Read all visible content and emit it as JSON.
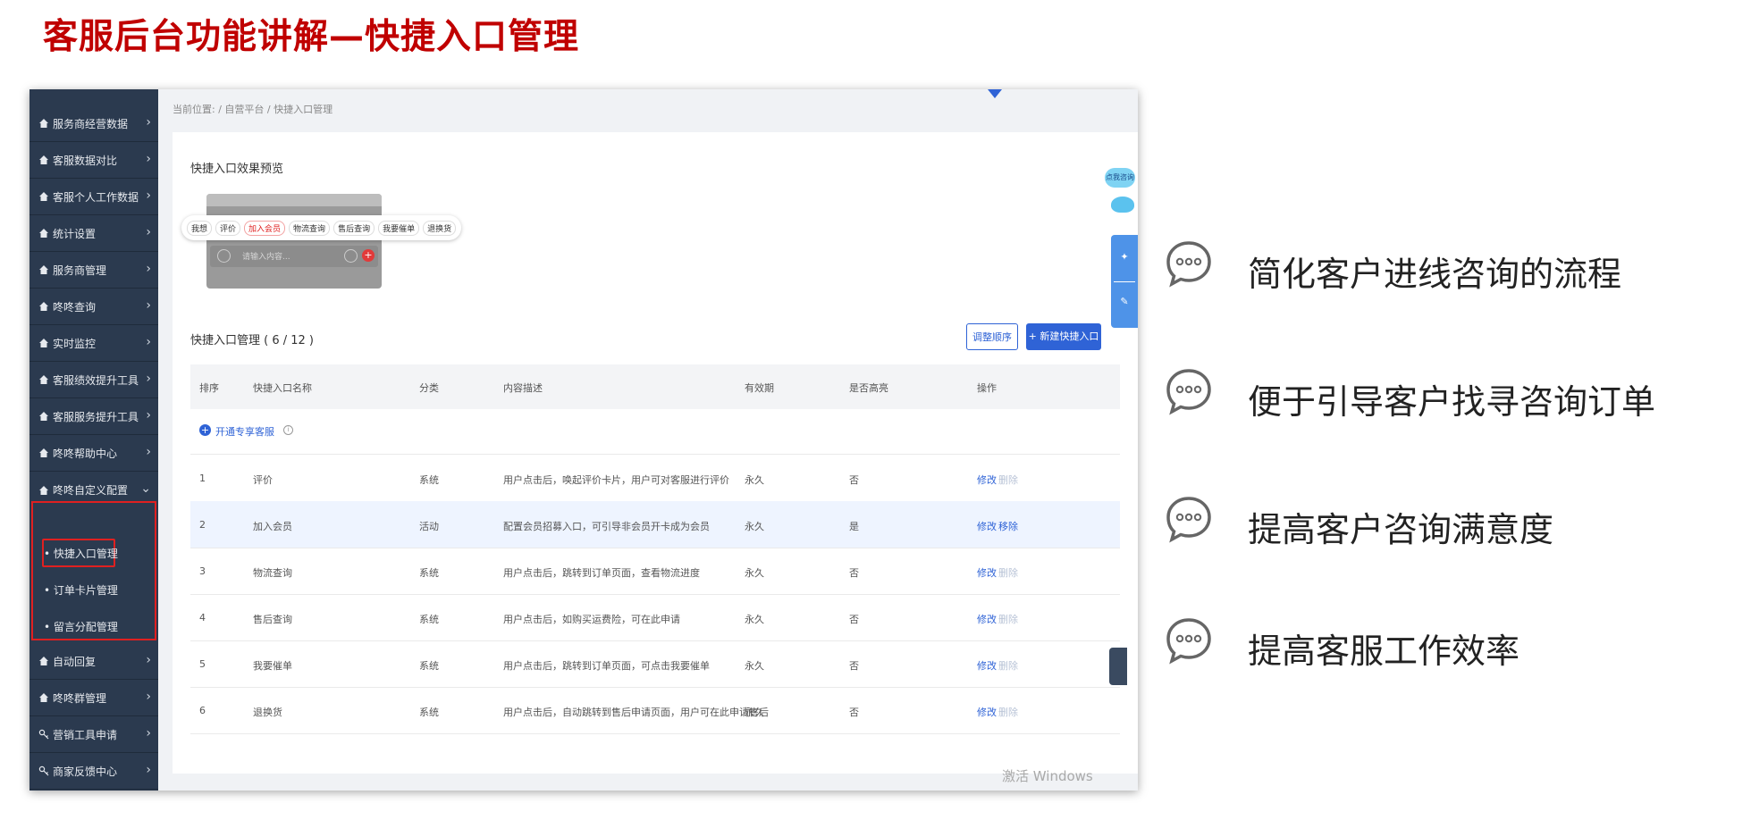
{
  "slide": {
    "title": "客服后台功能讲解—快捷入口管理"
  },
  "app": {
    "breadcrumb": "当前位置: / 自营平台 / 快捷入口管理",
    "sidebar": {
      "items": [
        {
          "label": "服务商经营数据"
        },
        {
          "label": "客服数据对比"
        },
        {
          "label": "客服个人工作数据"
        },
        {
          "label": "统计设置"
        },
        {
          "label": "服务商管理"
        },
        {
          "label": "咚咚查询"
        },
        {
          "label": "实时监控"
        },
        {
          "label": "客服绩效提升工具"
        },
        {
          "label": "客服服务提升工具"
        },
        {
          "label": "咚咚帮助中心"
        },
        {
          "label": "咚咚自定义配置"
        }
      ],
      "sub_items": [
        {
          "label": "• 快捷入口管理"
        },
        {
          "label": "• 订单卡片管理"
        },
        {
          "label": "• 留言分配管理"
        }
      ],
      "items_after": [
        {
          "label": "自动回复"
        },
        {
          "label": "咚咚群管理"
        },
        {
          "label": "营销工具申请"
        },
        {
          "label": "商家反馈中心"
        }
      ]
    },
    "preview": {
      "title": "快捷入口效果预览",
      "chips": [
        "我想",
        "评价",
        "加入会员",
        "物流查询",
        "售后查询",
        "我要催单",
        "退换货"
      ],
      "input_placeholder": "请输入内容...",
      "plus": "+"
    },
    "management": {
      "title": "快捷入口管理 ( 6 / 12 )",
      "adjust_order_label": "调整顺序",
      "new_entry_label": "+ 新建快捷入口",
      "columns": [
        "排序",
        "快捷入口名称",
        "分类",
        "内容描述",
        "有效期",
        "是否高亮",
        "操作"
      ],
      "open_exclusive_label": "开通专享客服",
      "open_plus": "+",
      "info": "i",
      "rows": [
        {
          "order": "1",
          "name": "评价",
          "category": "系统",
          "desc": "用户点击后，唤起评价卡片，用户可对客服进行评价",
          "validity": "永久",
          "highlight": "否",
          "edit": "修改",
          "remove": "删除"
        },
        {
          "order": "2",
          "name": "加入会员",
          "category": "活动",
          "desc": "配置会员招募入口，可引导非会员开卡成为会员",
          "validity": "永久",
          "highlight": "是",
          "edit": "修改",
          "remove": "移除"
        },
        {
          "order": "3",
          "name": "物流查询",
          "category": "系统",
          "desc": "用户点击后，跳转到订单页面，查看物流进度",
          "validity": "永久",
          "highlight": "否",
          "edit": "修改",
          "remove": "删除"
        },
        {
          "order": "4",
          "name": "售后查询",
          "category": "系统",
          "desc": "用户点击后，如购买运费险，可在此申请",
          "validity": "永久",
          "highlight": "否",
          "edit": "修改",
          "remove": "删除"
        },
        {
          "order": "5",
          "name": "我要催单",
          "category": "系统",
          "desc": "用户点击后，跳转到订单页面，可点击我要催单",
          "validity": "永久",
          "highlight": "否",
          "edit": "修改",
          "remove": "删除"
        },
        {
          "order": "6",
          "name": "退换货",
          "category": "系统",
          "desc": "用户点击后，自动跳转到售后申请页面，用户可在此申请售后",
          "validity": "永久",
          "highlight": "否",
          "edit": "修改",
          "remove": "删除"
        }
      ]
    },
    "float": {
      "badge": "点我咨询"
    },
    "watermark": "激活 Windows"
  },
  "points": [
    "简化客户进线咨询的流程",
    "便于引导客户找寻咨询订单",
    "提高客户咨询满意度",
    "提高客服工作效率"
  ],
  "colors": {
    "title_red": "#c00000",
    "sidebar_bg": "#2b3a4f",
    "primary_blue": "#2f63d6",
    "highlight_border": "#e02020"
  }
}
